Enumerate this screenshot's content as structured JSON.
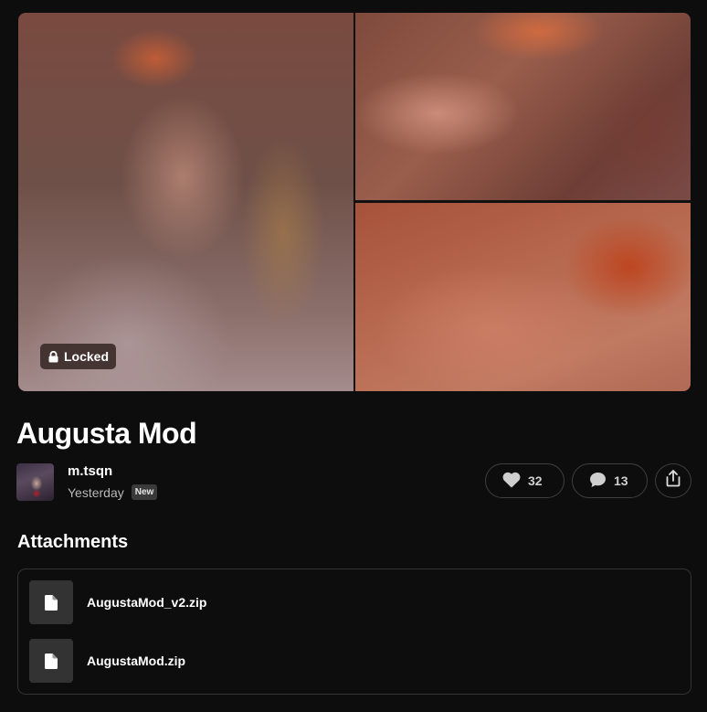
{
  "gallery": {
    "images": [
      "Blurred preview image 1",
      "Blurred preview image 2",
      "Blurred preview image 3"
    ],
    "locked_label": "Locked",
    "lock_icon": "lock-icon"
  },
  "post": {
    "title": "Augusta Mod",
    "author": "m.tsqn",
    "date": "Yesterday",
    "badge": "New"
  },
  "actions": {
    "likes": "32",
    "comments": "13",
    "like_icon": "heart-icon",
    "comment_icon": "speech-bubble-icon",
    "share_icon": "share-icon"
  },
  "attachments": {
    "heading": "Attachments",
    "files": [
      {
        "name": "AugustaMod_v2.zip",
        "icon": "file-icon"
      },
      {
        "name": "AugustaMod.zip",
        "icon": "file-icon"
      }
    ]
  }
}
